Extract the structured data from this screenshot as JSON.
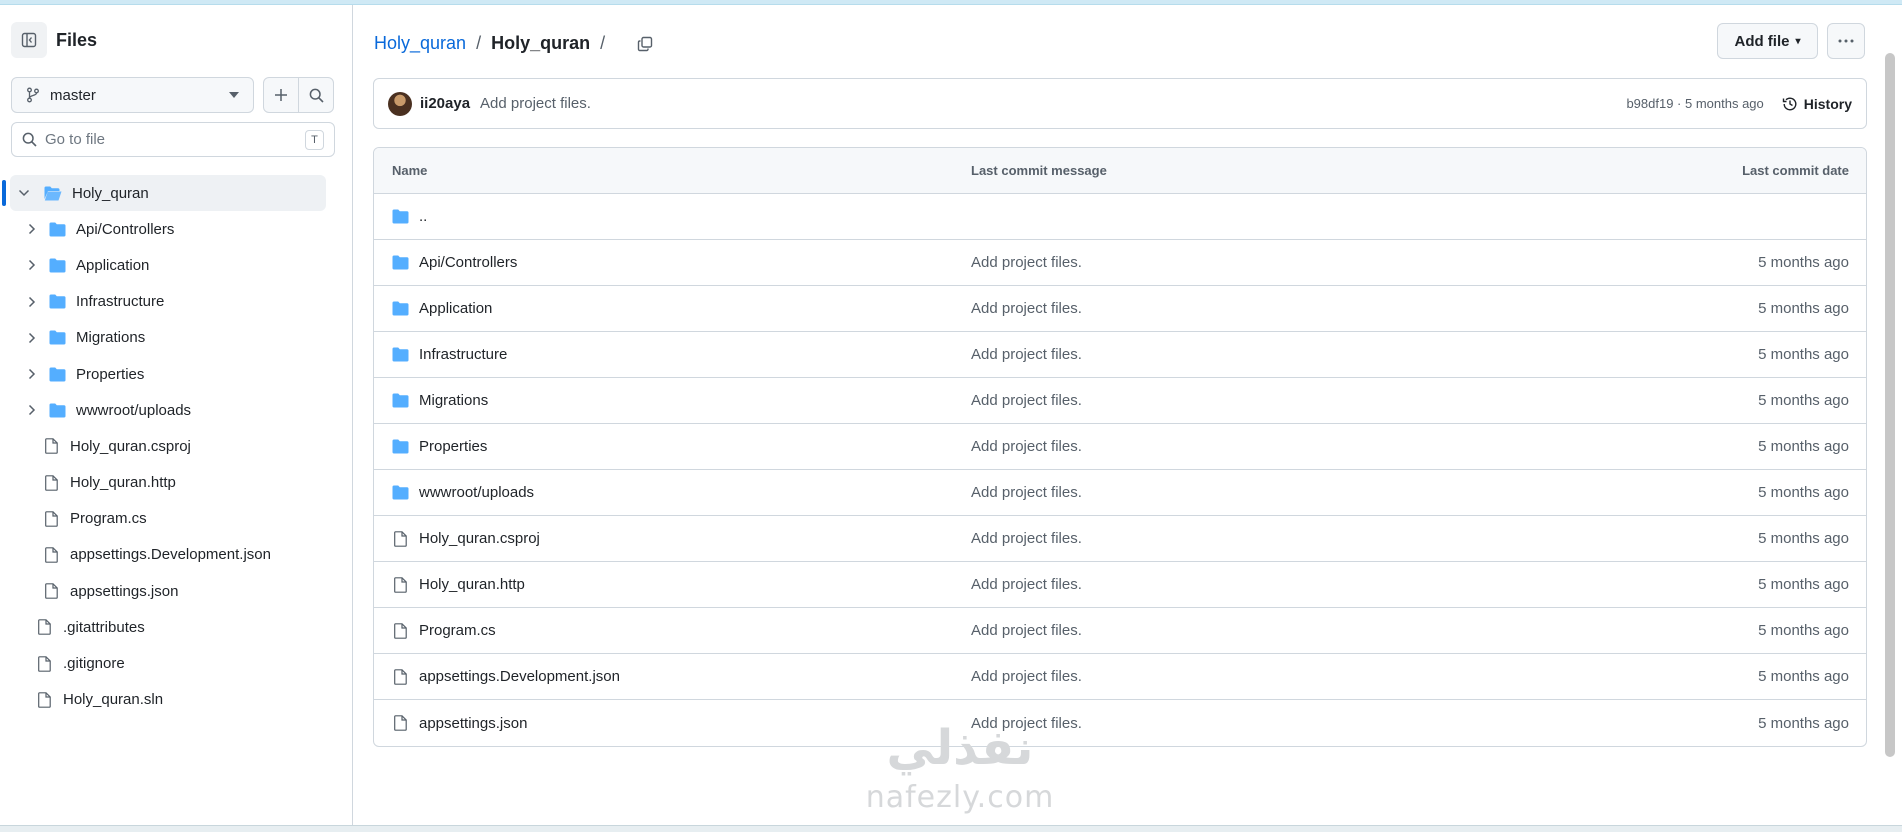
{
  "sidebar": {
    "title": "Files",
    "branch": "master",
    "goto_placeholder": "Go to file",
    "goto_shortcut": "T",
    "tree": [
      {
        "label": "Holy_quran",
        "type": "folder",
        "expanded": true,
        "level": 0,
        "active": true
      },
      {
        "label": "Api/Controllers",
        "type": "folder",
        "level": 1
      },
      {
        "label": "Application",
        "type": "folder",
        "level": 1
      },
      {
        "label": "Infrastructure",
        "type": "folder",
        "level": 1
      },
      {
        "label": "Migrations",
        "type": "folder",
        "level": 1
      },
      {
        "label": "Properties",
        "type": "folder",
        "level": 1
      },
      {
        "label": "wwwroot/uploads",
        "type": "folder",
        "level": 1
      },
      {
        "label": "Holy_quran.csproj",
        "type": "file",
        "level": 1
      },
      {
        "label": "Holy_quran.http",
        "type": "file",
        "level": 1
      },
      {
        "label": "Program.cs",
        "type": "file",
        "level": 1
      },
      {
        "label": "appsettings.Development.json",
        "type": "file",
        "level": 1
      },
      {
        "label": "appsettings.json",
        "type": "file",
        "level": 1
      },
      {
        "label": ".gitattributes",
        "type": "file",
        "level": 0
      },
      {
        "label": ".gitignore",
        "type": "file",
        "level": 0
      },
      {
        "label": "Holy_quran.sln",
        "type": "file",
        "level": 0
      }
    ]
  },
  "header": {
    "crumb_root": "Holy_quran",
    "crumb_current": "Holy_quran",
    "sep": "/",
    "add_file": "Add file"
  },
  "commit": {
    "author": "ii20aya",
    "message": "Add project files.",
    "meta": "b98df19 · 5 months ago",
    "history": "History"
  },
  "table": {
    "headers": {
      "name": "Name",
      "message": "Last commit message",
      "date": "Last commit date"
    },
    "parent": "..",
    "rows": [
      {
        "name": "Api/Controllers",
        "type": "folder",
        "message": "Add project files.",
        "date": "5 months ago"
      },
      {
        "name": "Application",
        "type": "folder",
        "message": "Add project files.",
        "date": "5 months ago"
      },
      {
        "name": "Infrastructure",
        "type": "folder",
        "message": "Add project files.",
        "date": "5 months ago"
      },
      {
        "name": "Migrations",
        "type": "folder",
        "message": "Add project files.",
        "date": "5 months ago"
      },
      {
        "name": "Properties",
        "type": "folder",
        "message": "Add project files.",
        "date": "5 months ago"
      },
      {
        "name": "wwwroot/uploads",
        "type": "folder",
        "message": "Add project files.",
        "date": "5 months ago"
      },
      {
        "name": "Holy_quran.csproj",
        "type": "file",
        "message": "Add project files.",
        "date": "5 months ago"
      },
      {
        "name": "Holy_quran.http",
        "type": "file",
        "message": "Add project files.",
        "date": "5 months ago"
      },
      {
        "name": "Program.cs",
        "type": "file",
        "message": "Add project files.",
        "date": "5 months ago"
      },
      {
        "name": "appsettings.Development.json",
        "type": "file",
        "message": "Add project files.",
        "date": "5 months ago"
      },
      {
        "name": "appsettings.json",
        "type": "file",
        "message": "Add project files.",
        "date": "5 months ago"
      }
    ]
  },
  "watermark": {
    "arabic": "نفذلي",
    "latin": "nafezly.com"
  },
  "colors": {
    "accent": "#0969da",
    "folder": "#54aeff",
    "border": "#d0d7de",
    "muted": "#57606a"
  }
}
